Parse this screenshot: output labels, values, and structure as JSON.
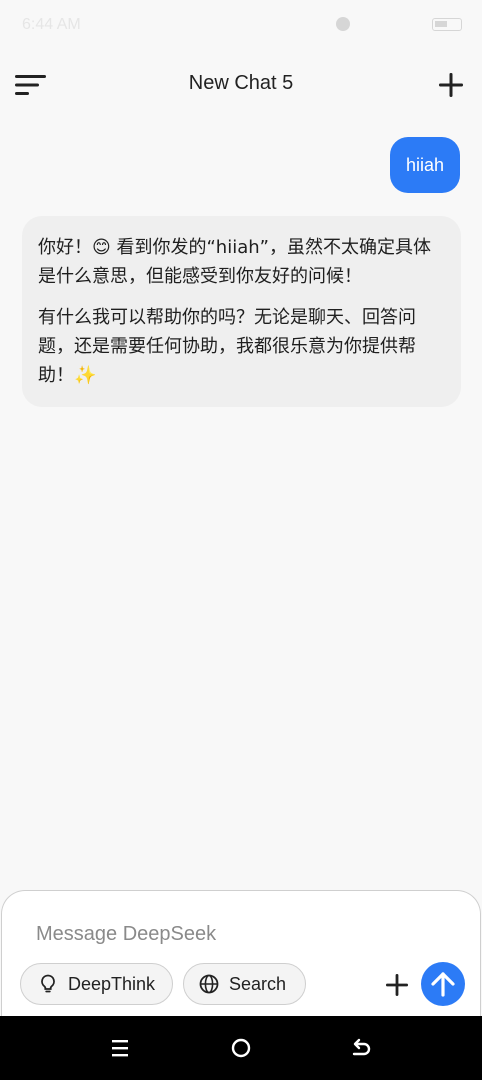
{
  "status_bar": {
    "time": "6:44 AM"
  },
  "header": {
    "title": "New Chat 5"
  },
  "messages": {
    "user": "hiiah",
    "bot_paragraph_1": "你好！😊 看到你发的“hiiah”，虽然不太确定具体是什么意思，但能感受到你友好的问候！",
    "bot_paragraph_2": "有什么我可以帮助你的吗？无论是聊天、回答问题，还是需要任何协助，我都很乐意为你提供帮助！✨"
  },
  "composer": {
    "placeholder": "Message DeepSeek",
    "deepthink_label": "DeepThink",
    "search_label": "Search"
  },
  "colors": {
    "accent": "#2c7bf6",
    "background": "#f8f8f8",
    "bot_bubble": "#efefef",
    "nav_bar": "#000000"
  },
  "icons": {
    "menu": "menu-lines-icon",
    "new_chat": "plus-icon",
    "deepthink": "lightbulb-icon",
    "search": "globe-icon",
    "attach": "plus-icon",
    "send": "arrow-up-icon",
    "nav_menu": "recent-apps-icon",
    "nav_home": "home-circle-icon",
    "nav_back": "back-arrow-icon"
  }
}
